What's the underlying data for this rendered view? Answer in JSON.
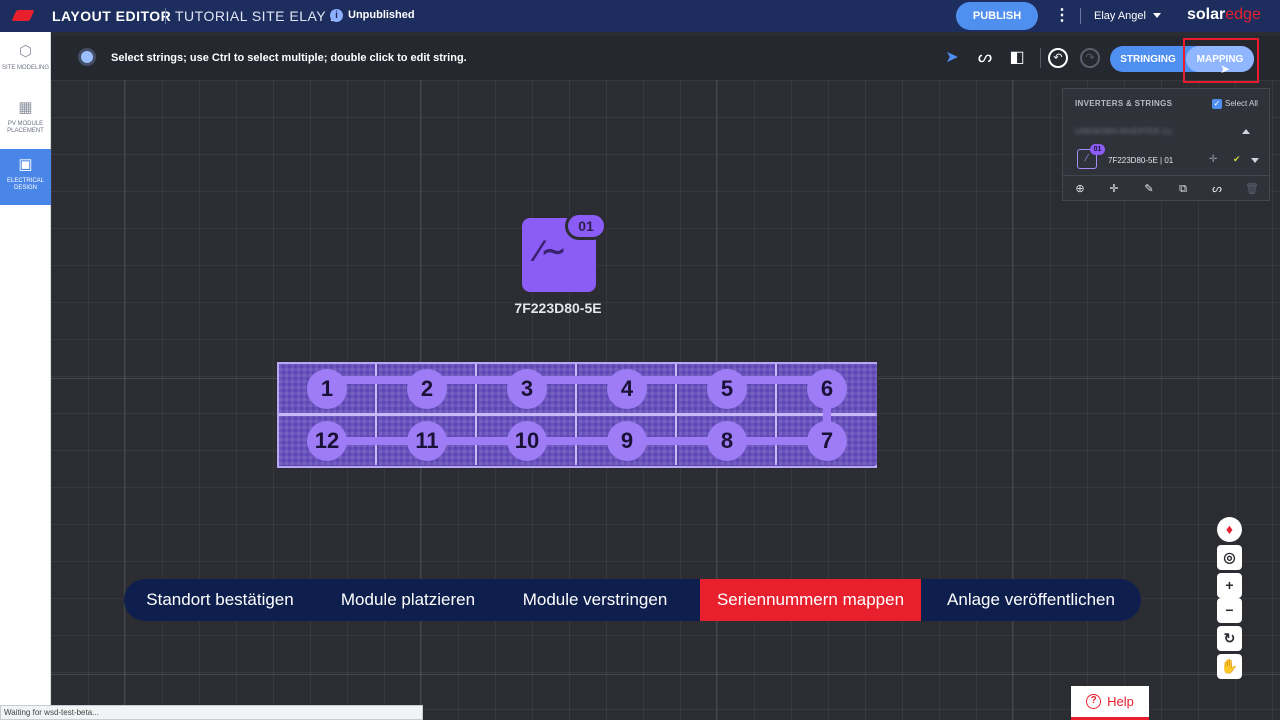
{
  "header": {
    "app_title": "LAYOUT EDITOR",
    "site_name": "TUTORIAL SITE ELAY 2",
    "status": "Unpublished",
    "publish_label": "PUBLISH",
    "user_name": "Elay Angel",
    "brand_solar": "solar",
    "brand_edge": "edge"
  },
  "sidebar": {
    "items": [
      {
        "label": "SITE MODELING",
        "icon": "cube-icon"
      },
      {
        "label": "PV MODULE PLACEMENT",
        "icon": "grid-icon"
      },
      {
        "label": "ELECTRICAL DESIGN",
        "icon": "chip-icon",
        "active": true
      }
    ]
  },
  "toolbar": {
    "hint": "Select strings; use Ctrl to select multiple; double click to edit string.",
    "stringing_label": "STRINGING",
    "mapping_label": "MAPPING"
  },
  "canvas": {
    "inverter_badge": "01",
    "inverter_label": "7F223D80-5E",
    "modules_top": [
      "1",
      "2",
      "3",
      "4",
      "5",
      "6"
    ],
    "modules_bottom": [
      "12",
      "11",
      "10",
      "9",
      "8",
      "7"
    ]
  },
  "panel": {
    "title": "INVERTERS & STRINGS",
    "select_all": "Select All",
    "group_blurred": "UNKNOWN INVERTER (1)",
    "inverter_badge": "01",
    "inverter_row": "7F223D80-5E",
    "inverter_row_suffix": "| 01"
  },
  "steps": {
    "items": [
      "Standort bestätigen",
      "Module platzieren",
      "Module verstringen",
      "Seriennummern mappen",
      "Anlage veröffentlichen"
    ],
    "current_index": 3
  },
  "help_label": "Help",
  "status_bar": "Waiting for wsd-test-beta..."
}
